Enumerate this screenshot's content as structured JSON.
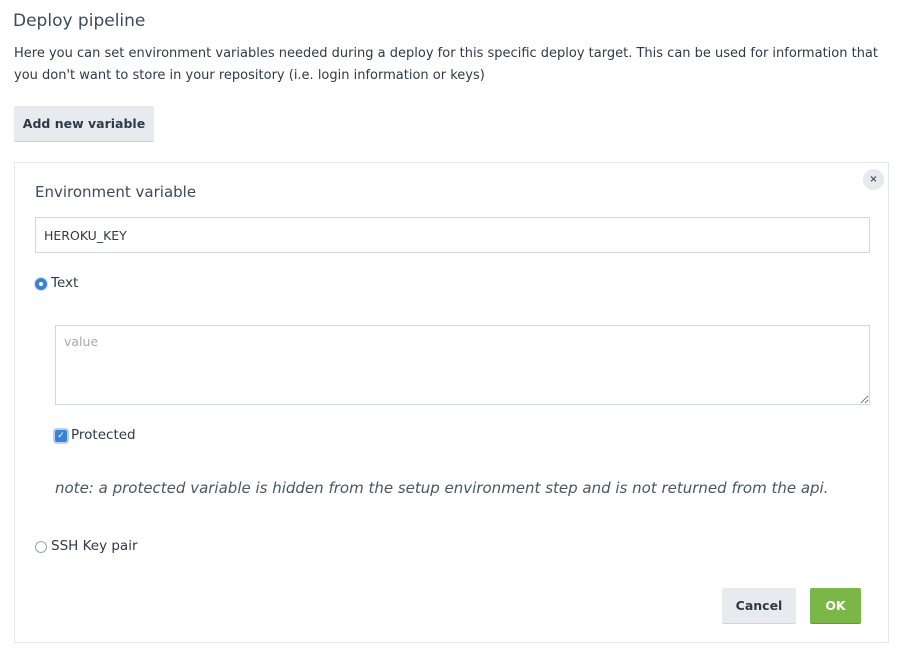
{
  "section": {
    "title": "Deploy pipeline",
    "description": "Here you can set environment variables needed during a deploy for this specific deploy target. This can be used for information that you don't want to store in your repository (i.e. login information or keys)",
    "add_button_label": "Add new variable"
  },
  "panel": {
    "close_label": "×",
    "field_label": "Environment variable",
    "name_value": "HEROKU_KEY",
    "type_options": [
      {
        "label": "Text",
        "checked": true
      },
      {
        "label": "SSH Key pair",
        "checked": false
      }
    ],
    "value_placeholder": "value",
    "protected": {
      "label": "Protected",
      "checked": true,
      "check_glyph": "✓"
    },
    "note": "note: a protected variable is hidden from the setup environment step and is not returned from the api.",
    "cancel_label": "Cancel",
    "ok_label": "OK"
  },
  "colors": {
    "accent": "#3b82d6",
    "ok_button": "#7ab648",
    "secondary_button": "#e7ebef"
  }
}
